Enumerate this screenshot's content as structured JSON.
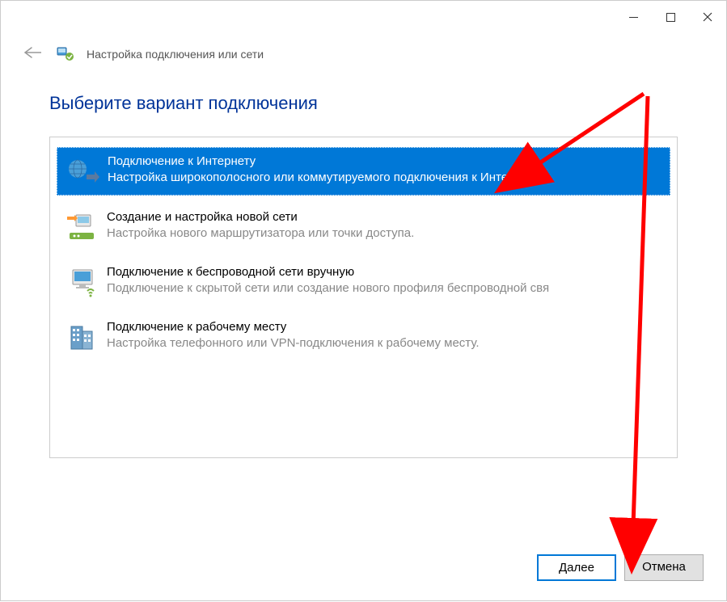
{
  "header": {
    "title": "Настройка подключения или сети"
  },
  "main": {
    "heading": "Выберите вариант подключения",
    "options": [
      {
        "title": "Подключение к Интернету",
        "desc": "Настройка широкополосного или коммутируемого подключения к Интернету.",
        "icon": "globe-arrow",
        "selected": true
      },
      {
        "title": "Создание и настройка новой сети",
        "desc": "Настройка нового маршрутизатора или точки доступа.",
        "icon": "router-setup",
        "selected": false
      },
      {
        "title": "Подключение к беспроводной сети вручную",
        "desc": "Подключение к скрытой сети или создание нового профиля беспроводной свя",
        "icon": "monitor-wireless",
        "selected": false
      },
      {
        "title": "Подключение к рабочему месту",
        "desc": "Настройка телефонного или VPN-подключения к рабочему месту.",
        "icon": "building",
        "selected": false
      }
    ]
  },
  "footer": {
    "next": "Далее",
    "cancel": "Отмена"
  },
  "colors": {
    "heading": "#003399",
    "selection": "#0078d7",
    "arrow": "#ff0000"
  }
}
